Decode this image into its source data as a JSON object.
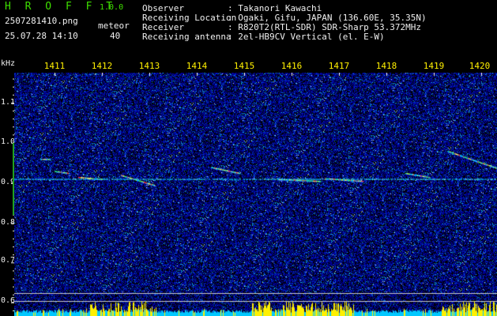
{
  "header": {
    "logo": "H R O F F T",
    "version": "1.0.0",
    "filename": "2507281410.png",
    "meteor_label": "meteor",
    "datetime": "25.07.28 14:10",
    "meteor_count": "40",
    "rows": [
      {
        "label": "Observer",
        "value": ": Takanori Kawachi"
      },
      {
        "label": "Receiving Location",
        "value": ": Ogaki, Gifu, JAPAN (136.60E, 35.35N)"
      },
      {
        "label": "Receiver",
        "value": ": R820T2(RTL-SDR) SDR-Sharp 53.372MHz"
      },
      {
        "label": "Receiving antenna",
        "value": ": 2el-HB9CV Vertical (el. E-W)"
      }
    ]
  },
  "axes": {
    "y_unit": "kHz",
    "x_ticks": [
      "1411",
      "1412",
      "1413",
      "1414",
      "1415",
      "1416",
      "1417",
      "1418",
      "1419",
      "1420"
    ],
    "y_ticks": [
      "1.1",
      "1.0",
      "0.9",
      "0.8",
      "0.7",
      "0.6"
    ]
  },
  "colors": {
    "background": "#000000",
    "noise_base": "#0a0a8a",
    "header_green": "#3fe000",
    "tick_yellow": "#fff000",
    "carrier": "#00e0ff",
    "power_cyan": "#00c8ff",
    "power_yellow": "#fff000"
  },
  "chart_data": {
    "type": "heatmap",
    "x_range": [
      1410.7,
      1420.4
    ],
    "y_range": [
      0.57,
      1.19
    ],
    "carrier_frequency": 0.91,
    "echoes": [
      {
        "x": [
          1410.7,
          1410.9
        ],
        "y": [
          0.96,
          0.96
        ]
      },
      {
        "x": [
          1411.0,
          1411.3
        ],
        "y": [
          0.93,
          0.925
        ]
      },
      {
        "x": [
          1411.5,
          1412.0
        ],
        "y": [
          0.915,
          0.91
        ]
      },
      {
        "x": [
          1412.4,
          1413.1
        ],
        "y": [
          0.92,
          0.895
        ]
      },
      {
        "x": [
          1414.3,
          1414.9
        ],
        "y": [
          0.94,
          0.925
        ]
      },
      {
        "x": [
          1415.7,
          1416.6
        ],
        "y": [
          0.91,
          0.905
        ]
      },
      {
        "x": [
          1416.7,
          1417.5
        ],
        "y": [
          0.912,
          0.905
        ]
      },
      {
        "x": [
          1418.4,
          1418.9
        ],
        "y": [
          0.925,
          0.915
        ]
      },
      {
        "x": [
          1419.3,
          1419.9
        ],
        "y": [
          0.98,
          0.955
        ]
      },
      {
        "x": [
          1419.9,
          1420.4
        ],
        "y": [
          0.955,
          0.935
        ]
      }
    ]
  }
}
